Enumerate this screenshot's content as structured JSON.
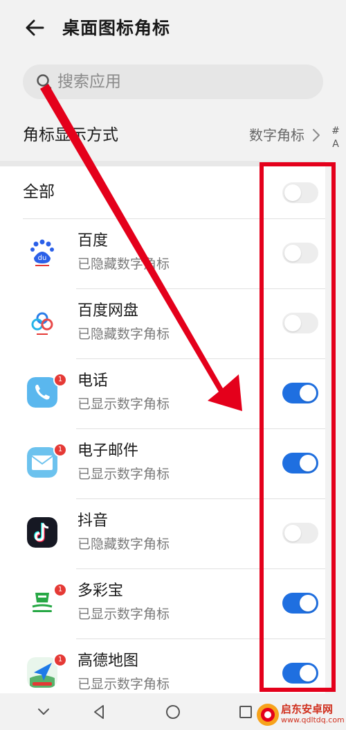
{
  "header": {
    "title": "桌面图标角标"
  },
  "search": {
    "placeholder": "搜索应用"
  },
  "badge_mode": {
    "label": "角标显示方式",
    "value": "数字角标"
  },
  "all_row": {
    "label": "全部",
    "enabled": false
  },
  "apps": [
    {
      "name": "百度",
      "status": "已隐藏数字角标",
      "enabled": false,
      "badge": "",
      "icon": "baidu-icon"
    },
    {
      "name": "百度网盘",
      "status": "已隐藏数字角标",
      "enabled": false,
      "badge": "",
      "icon": "baidu-netdisk-icon"
    },
    {
      "name": "电话",
      "status": "已显示数字角标",
      "enabled": true,
      "badge": "1",
      "icon": "phone-icon"
    },
    {
      "name": "电子邮件",
      "status": "已显示数字角标",
      "enabled": true,
      "badge": "1",
      "icon": "email-icon"
    },
    {
      "name": "抖音",
      "status": "已隐藏数字角标",
      "enabled": false,
      "badge": "",
      "icon": "douyin-icon"
    },
    {
      "name": "多彩宝",
      "status": "已显示数字角标",
      "enabled": true,
      "badge": "1",
      "icon": "duocaibao-icon"
    },
    {
      "name": "高德地图",
      "status": "已显示数字角标",
      "enabled": true,
      "badge": "1",
      "icon": "amap-icon"
    }
  ],
  "index_letters": [
    "#",
    "A"
  ],
  "watermark": {
    "name": "启东安卓网",
    "url": "www.qdltdq.com"
  },
  "colors": {
    "toggle_on": "#1f6fe0",
    "annotation_red": "#e4001b",
    "badge_red": "#e53935"
  }
}
